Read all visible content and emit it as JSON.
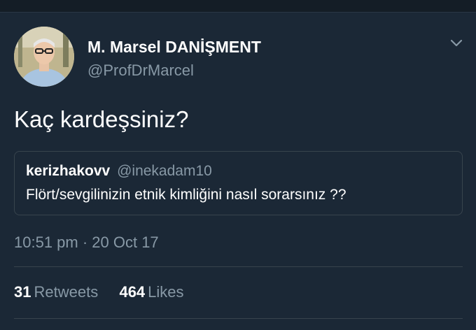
{
  "tweet": {
    "author_name": "M. Marsel DANİŞMENT",
    "author_handle": "@ProfDrMarcel",
    "avatar_icon": "user-avatar-photo",
    "menu_icon": "chevron-down-icon",
    "text": "Kaç kardeşsiniz?",
    "timestamp": "10:51 pm · 20 Oct 17",
    "retweets_count": "31",
    "retweets_label": "Retweets",
    "likes_count": "464",
    "likes_label": "Likes"
  },
  "quoted_tweet": {
    "author_name": "kerizhakovv",
    "author_handle": "@inekadam10",
    "text": "Flört/sevgilinizin etnik kimliğini nasıl sorarsınız ??"
  },
  "colors": {
    "background": "#1b2836",
    "primary_text": "#ffffff",
    "secondary_text": "#8899a6",
    "border": "#38444d"
  }
}
